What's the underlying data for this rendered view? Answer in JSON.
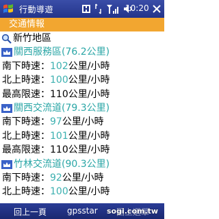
{
  "status_bar": {
    "title": "行動導遊",
    "time": "10:20"
  },
  "section_title": "交通情報",
  "region": "新竹地區",
  "stations": [
    {
      "name": "關西服務區(76.2公里)",
      "rows": [
        {
          "label": "南下時速：",
          "value": "102",
          "unit": "公里/小時"
        },
        {
          "label": "北上時速：",
          "value": "100",
          "unit": "公里/小時"
        },
        {
          "label": "最高限速：",
          "value": "110",
          "unit": "公里/小時"
        }
      ]
    },
    {
      "name": "關西交流道(79.3公里)",
      "rows": [
        {
          "label": "南下時速：",
          "value": "97",
          "unit": "公里/小時"
        },
        {
          "label": "北上時速：",
          "value": "101",
          "unit": "公里/小時"
        },
        {
          "label": "最高限速：",
          "value": "110",
          "unit": "公里/小時"
        }
      ]
    },
    {
      "name": "竹林交流道(90.3公里)",
      "rows": [
        {
          "label": "南下時速：",
          "value": "92",
          "unit": "公里/小時"
        },
        {
          "label": "北上時速：",
          "value": "100",
          "unit": "公里/小時"
        }
      ]
    }
  ],
  "softkeys": {
    "left": "回上一頁",
    "center": "gpsstar",
    "right": "回上選單"
  },
  "watermark": "sogi.com.tw"
}
